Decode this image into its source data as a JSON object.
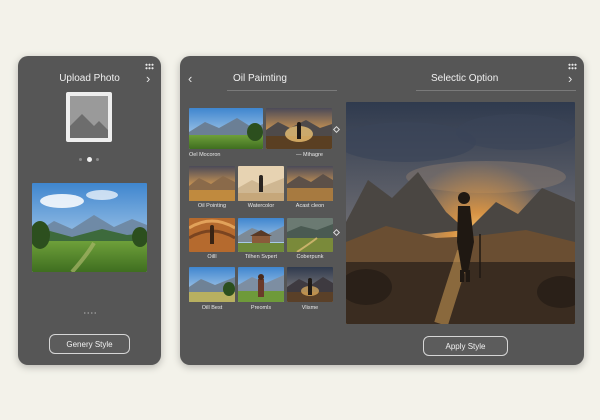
{
  "left": {
    "title": "Upload Photo",
    "upload_icon": "image-placeholder-icon",
    "button": "Genery Style"
  },
  "right": {
    "title": "Oil Paimting",
    "subtitle": "Selectic Option",
    "button": "Apply Style",
    "styles": [
      {
        "label": "Oel Mocoron"
      },
      {
        "label": "— Mihagre"
      },
      {
        "label": "Oil Pointing"
      },
      {
        "label": "Watercolor"
      },
      {
        "label": "Acast cleon"
      },
      {
        "label": "Oilll"
      },
      {
        "label": "Tilhen Svpert"
      },
      {
        "label": "Coberpunk"
      },
      {
        "label": "Oill Best"
      },
      {
        "label": "Preomls"
      },
      {
        "label": "Vlisme"
      }
    ]
  },
  "colors": {
    "background": "#f3f2ea",
    "panel": "#565656",
    "accent_glow": "#f2b04a"
  }
}
